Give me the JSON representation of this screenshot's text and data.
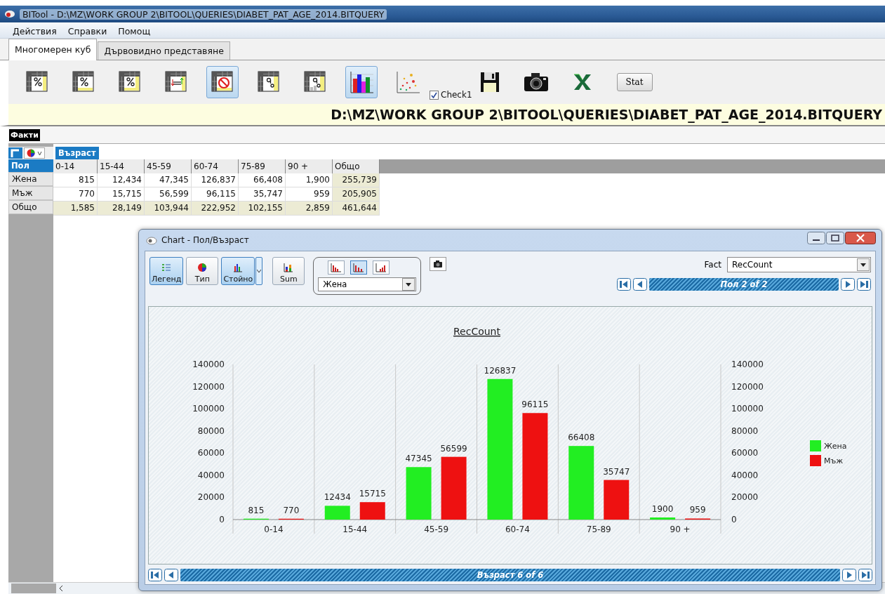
{
  "window": {
    "title": "BITool - D:\\MZ\\WORK GROUP 2\\BITOOL\\QUERIES\\DIABET_PAT_AGE_2014.BITQUERY"
  },
  "menu": [
    "Действия",
    "Справки",
    "Помощ"
  ],
  "tabs": [
    {
      "label": "Многомерен куб",
      "selected": true
    },
    {
      "label": "Дървовидно представяне",
      "selected": false
    }
  ],
  "toolbar": {
    "tools": [
      {
        "selected": false
      },
      {
        "selected": false
      },
      {
        "selected": false
      },
      {
        "selected": false
      },
      {
        "selected": true
      },
      {
        "selected": false
      },
      {
        "selected": false
      },
      {
        "selected": true
      },
      {
        "selected": false
      },
      {
        "selected": false
      },
      {
        "selected": false
      },
      {
        "selected": false
      }
    ],
    "checkbox": {
      "label": "Check1",
      "checked": true
    },
    "button": "Stat"
  },
  "path_banner": "D:\\MZ\\WORK GROUP 2\\BITOOL\\QUERIES\\DIABET_PAT_AGE_2014.BITQUERY",
  "facts_label": "Факти",
  "pivot": {
    "column_dimension": "Възраст",
    "row_dimension": "Пол",
    "columns": [
      {
        "label": "0-14",
        "kind": "data"
      },
      {
        "label": "15-44",
        "kind": "data"
      },
      {
        "label": "45-59",
        "kind": "data"
      },
      {
        "label": "60-74",
        "kind": "data"
      },
      {
        "label": "75-89",
        "kind": "data"
      },
      {
        "label": "90 +",
        "kind": "data"
      },
      {
        "label": "Общо",
        "kind": "total"
      }
    ],
    "rows": [
      {
        "label": "Жена",
        "kind": "data",
        "cells": [
          "815",
          "12,434",
          "47,345",
          "126,837",
          "66,408",
          "1,900",
          "255,739"
        ]
      },
      {
        "label": "Мъж",
        "kind": "data",
        "cells": [
          "770",
          "15,715",
          "56,599",
          "96,115",
          "35,747",
          "959",
          "205,905"
        ]
      },
      {
        "label": "Общо",
        "kind": "total",
        "cells": [
          "1,585",
          "28,149",
          "103,944",
          "222,952",
          "102,155",
          "2,859",
          "461,644"
        ]
      }
    ]
  },
  "chart_window": {
    "title": "Chart - Пол/Възраст",
    "view_buttons": [
      {
        "label": "Легенд",
        "selected": true
      },
      {
        "label": "Тип",
        "selected": false
      },
      {
        "label": "Стойно",
        "selected": true
      },
      {
        "label": "Sum",
        "selected": false
      }
    ],
    "type_buttons": [
      {
        "selected": false
      },
      {
        "selected": true
      },
      {
        "selected": false
      }
    ],
    "series_select": "Жена",
    "fact_label": "Fact",
    "fact_value": "RecCount",
    "top_navigator": "Пол 2 of 2",
    "bottom_navigator": "Възраст 6 of 6",
    "chart_data": {
      "type": "bar",
      "title": "RecCount",
      "categories": [
        "0-14",
        "15-44",
        "45-59",
        "60-74",
        "75-89",
        "90 +"
      ],
      "series": [
        {
          "name": "Жена",
          "color": "#22ee22",
          "values": [
            815,
            12434,
            47345,
            126837,
            66408,
            1900
          ]
        },
        {
          "name": "Мъж",
          "color": "#ee1111",
          "values": [
            770,
            15715,
            56599,
            96115,
            35747,
            959
          ]
        }
      ],
      "ylim": [
        0,
        140000
      ],
      "yticks": [
        0,
        20000,
        40000,
        60000,
        80000,
        100000,
        120000,
        140000
      ],
      "y2lim": [
        0,
        140000
      ],
      "y2ticks": [
        0,
        20000,
        40000,
        60000,
        80000,
        100000,
        120000,
        140000
      ],
      "value_labels": [
        [
          "815",
          "12434",
          "47345",
          "126837",
          "66408",
          "1900"
        ],
        [
          "770",
          "15715",
          "56599",
          "96115",
          "35747",
          "959"
        ]
      ],
      "legend": true
    }
  }
}
